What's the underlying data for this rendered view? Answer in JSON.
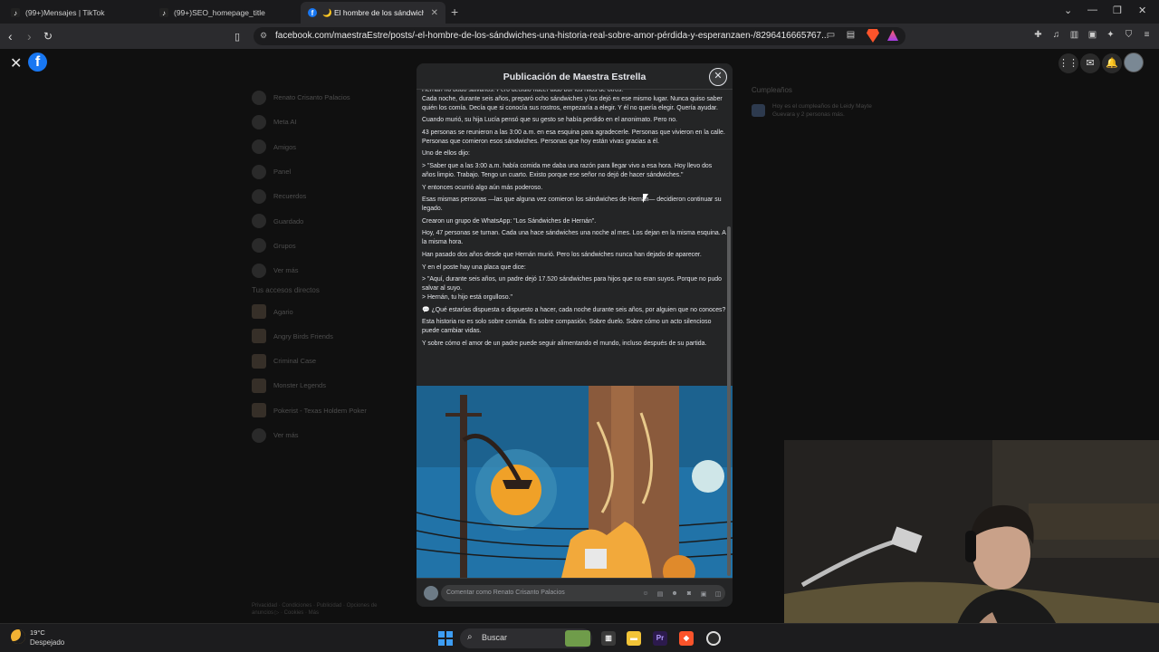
{
  "browser": {
    "tabs": [
      {
        "icon": "tiktok-icon",
        "label": "(99+)Mensajes | TikTok"
      },
      {
        "icon": "tiktok-icon",
        "label": "(99+)SEO_homepage_title"
      },
      {
        "icon": "facebook-icon",
        "label": "🌙 El hombre de los sándwiches"
      }
    ],
    "url": "facebook.com/maestraEstre/posts/-el-hombre-de-los-sándwiches-una-historia-real-sobre-amor-pérdida-y-esperanzaen-/8296416665767..."
  },
  "left_sidebar": {
    "items": [
      {
        "label": "Renato Crisanto Palacios"
      },
      {
        "label": "Meta AI"
      },
      {
        "label": "Amigos"
      },
      {
        "label": "Panel"
      },
      {
        "label": "Recuerdos"
      },
      {
        "label": "Guardado"
      },
      {
        "label": "Grupos"
      },
      {
        "label": "Ver más"
      }
    ],
    "shortcuts_heading": "Tus accesos directos",
    "shortcuts": [
      {
        "label": "Agario"
      },
      {
        "label": "Angry Birds Friends"
      },
      {
        "label": "Criminal Case"
      },
      {
        "label": "Monster Legends"
      },
      {
        "label": "Pokerist - Texas Holdem Poker"
      },
      {
        "label": "Ver más"
      }
    ],
    "footer": "Privacidad · Condiciones · Publicidad · Opciones de anuncios ▷ · Cookies · Más"
  },
  "right_sidebar": {
    "birthdays_title": "Cumpleaños",
    "birthdays_text": "Hoy es el cumpleaños de Leidy Mayte Guevara y 2 personas más."
  },
  "modal": {
    "title": "Publicación de Maestra Estrella",
    "cut_line": "Hernán no pudo salvarlos. Pero decidió hacer algo por los hijos de otros.",
    "paragraphs": [
      "Cada noche, durante seis años, preparó ocho sándwiches y los dejó en ese mismo lugar. Nunca quiso saber quién los comía. Decía que si conocía sus rostros, empezaría a elegir. Y él no quería elegir. Quería ayudar.",
      "Cuando murió, su hija Lucía pensó que su gesto se había perdido en el anonimato. Pero no.",
      "43 personas se reunieron a las 3:00 a.m. en esa esquina para agradecerle. Personas que vivieron en la calle. Personas que comieron esos sándwiches. Personas que hoy están vivas gracias a él.",
      "Uno de ellos dijo:",
      "> \"Saber que a las 3:00 a.m. había comida me daba una razón para llegar vivo a esa hora. Hoy llevo dos años limpio. Trabajo. Tengo un cuarto. Existo porque ese señor no dejó de hacer sándwiches.\"",
      "Y entonces ocurrió algo aún más poderoso.",
      "Esas mismas personas —las que alguna vez comieron los sándwiches de Hernán— decidieron continuar su legado.",
      "Crearon un grupo de WhatsApp: \"Los Sándwiches de Hernán\".",
      "Hoy, 47 personas se turnan. Cada una hace sándwiches una noche al mes. Los dejan en la misma esquina. A la misma hora.",
      "Han pasado dos años desde que Hernán murió. Pero los sándwiches nunca han dejado de aparecer.",
      "Y en el poste hay una placa que dice:",
      "> \"Aquí, durante seis años, un padre dejó 17.520 sándwiches para hijos que no eran suyos. Porque no pudo salvar al suyo.\n> Hernán, tu hijo está orgulloso.\"",
      "💬 ¿Qué estarías dispuesta o dispuesto a hacer, cada noche durante seis años, por alguien que no conoces?",
      "Esta historia no es solo sobre comida. Es sobre compasión. Sobre duelo. Sobre cómo un acto silencioso puede cambiar vidas.",
      "Y sobre cómo el amor de un padre puede seguir alimentando el mundo, incluso después de su partida."
    ],
    "comment_placeholder": "Comentar como Renato Crisanto Palacios"
  },
  "taskbar": {
    "temperature": "19°C",
    "weather": "Despejado",
    "search_label": "Buscar"
  },
  "colors": {
    "facebook_blue": "#1877f2",
    "modal_bg": "#242526",
    "text": "#e4e6eb"
  }
}
